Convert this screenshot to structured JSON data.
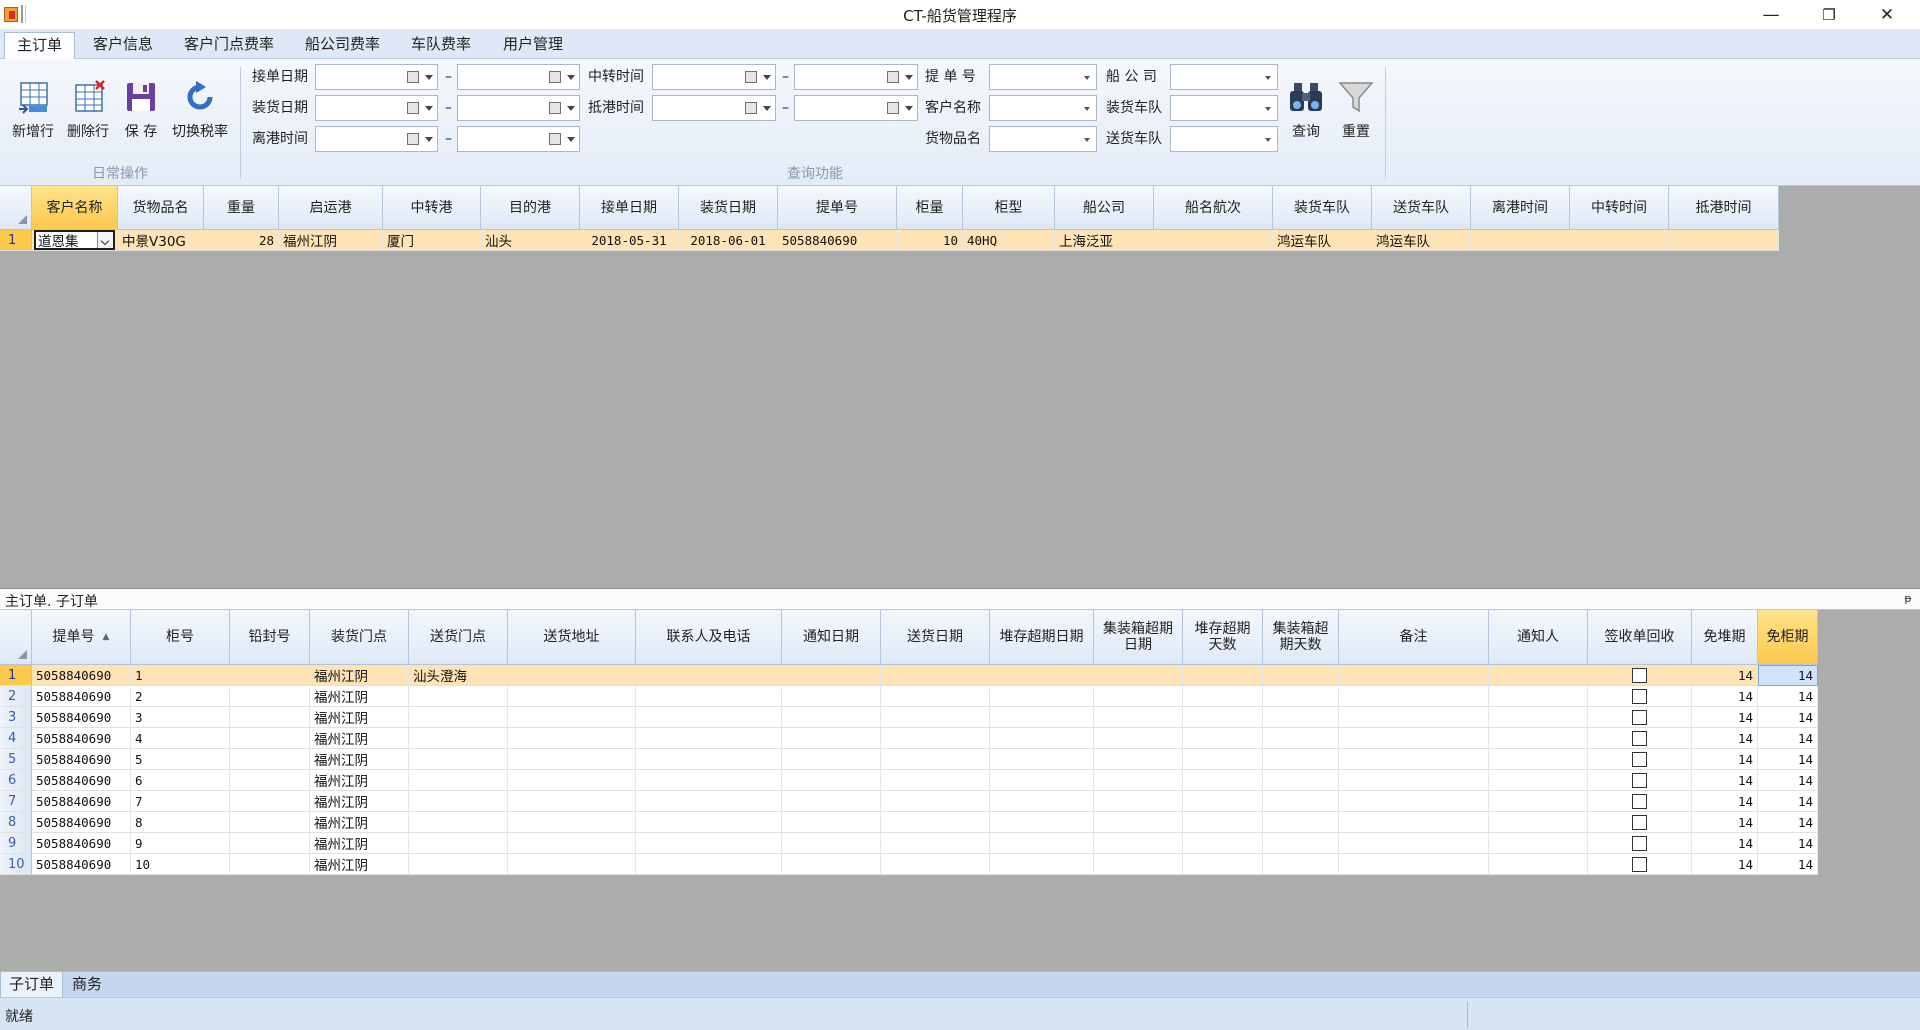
{
  "window": {
    "title": "CT-船货管理程序",
    "minimize": "—",
    "restore": "❐",
    "close": "✕"
  },
  "main_tabs": [
    {
      "label": "主订单",
      "active": true
    },
    {
      "label": "客户信息"
    },
    {
      "label": "客户门点费率"
    },
    {
      "label": "船公司费率"
    },
    {
      "label": "车队费率"
    },
    {
      "label": "用户管理"
    }
  ],
  "ribbon": {
    "daily_group_label": "日常操作",
    "query_group_label": "查询功能",
    "buttons": {
      "add_row": "新增行",
      "delete_row": "删除行",
      "save": "保 存",
      "switch_tax": "切换税率",
      "query": "查询",
      "reset": "重置"
    },
    "query": {
      "order_date": "接单日期",
      "load_date": "装货日期",
      "depart_time": "离港时间",
      "transfer_time": "中转时间",
      "arrive_time": "抵港时间",
      "bill_no": "提 单 号",
      "customer_name": "客户名称",
      "goods_name": "货物品名",
      "ship_company": "船 公 司",
      "load_team": "装货车队",
      "deliver_team": "送货车队",
      "dash": "–"
    }
  },
  "top_grid": {
    "columns": [
      "客户名称",
      "货物品名",
      "重量",
      "启运港",
      "中转港",
      "目的港",
      "接单日期",
      "装货日期",
      "提单号",
      "柜量",
      "柜型",
      "船公司",
      "船名航次",
      "装货车队",
      "送货车队",
      "离港时间",
      "中转时间",
      "抵港时间"
    ],
    "rows": [
      {
        "num": "1",
        "customer": "道恩集",
        "goods": "中景V30G",
        "weight": "28",
        "origin": "福州江阴",
        "transfer": "厦门",
        "dest": "汕头",
        "order_date": "2018-05-31",
        "load_date": "2018-06-01",
        "bill_no": "5058840690",
        "qty": "10",
        "type": "40HQ",
        "ship_company": "上海泛亚",
        "voyage": "",
        "load_team": "鸿运车队",
        "deliver_team": "鸿运车队",
        "depart": "",
        "transfer_time": "",
        "arrive": ""
      }
    ]
  },
  "sub_panel": {
    "title": "主订单. 子订单",
    "pin": "ᵽ"
  },
  "bottom_grid": {
    "columns": [
      "提单号",
      "柜号",
      "铅封号",
      "装货门点",
      "送货门点",
      "送货地址",
      "联系人及电话",
      "通知日期",
      "送货日期",
      "堆存超期日期",
      "集装箱超期日期",
      "堆存超期天数",
      "集装箱超期天数",
      "备注",
      "通知人",
      "签收单回收",
      "免堆期",
      "免柜期"
    ],
    "rows": [
      {
        "num": "1",
        "bill": "5058840690",
        "box": "1",
        "load_point": "福州江阴",
        "deliver_point": "汕头澄海",
        "free_store": "14",
        "free_box": "14"
      },
      {
        "num": "2",
        "bill": "5058840690",
        "box": "2",
        "load_point": "福州江阴",
        "deliver_point": "",
        "free_store": "14",
        "free_box": "14"
      },
      {
        "num": "3",
        "bill": "5058840690",
        "box": "3",
        "load_point": "福州江阴",
        "deliver_point": "",
        "free_store": "14",
        "free_box": "14"
      },
      {
        "num": "4",
        "bill": "5058840690",
        "box": "4",
        "load_point": "福州江阴",
        "deliver_point": "",
        "free_store": "14",
        "free_box": "14"
      },
      {
        "num": "5",
        "bill": "5058840690",
        "box": "5",
        "load_point": "福州江阴",
        "deliver_point": "",
        "free_store": "14",
        "free_box": "14"
      },
      {
        "num": "6",
        "bill": "5058840690",
        "box": "6",
        "load_point": "福州江阴",
        "deliver_point": "",
        "free_store": "14",
        "free_box": "14"
      },
      {
        "num": "7",
        "bill": "5058840690",
        "box": "7",
        "load_point": "福州江阴",
        "deliver_point": "",
        "free_store": "14",
        "free_box": "14"
      },
      {
        "num": "8",
        "bill": "5058840690",
        "box": "8",
        "load_point": "福州江阴",
        "deliver_point": "",
        "free_store": "14",
        "free_box": "14"
      },
      {
        "num": "9",
        "bill": "5058840690",
        "box": "9",
        "load_point": "福州江阴",
        "deliver_point": "",
        "free_store": "14",
        "free_box": "14"
      },
      {
        "num": "10",
        "bill": "5058840690",
        "box": "10",
        "load_point": "福州江阴",
        "deliver_point": "",
        "free_store": "14",
        "free_box": "14"
      }
    ]
  },
  "bottom_tabs": [
    {
      "label": "子订单",
      "active": true
    },
    {
      "label": "商务"
    }
  ],
  "status": {
    "text": "就绪"
  }
}
